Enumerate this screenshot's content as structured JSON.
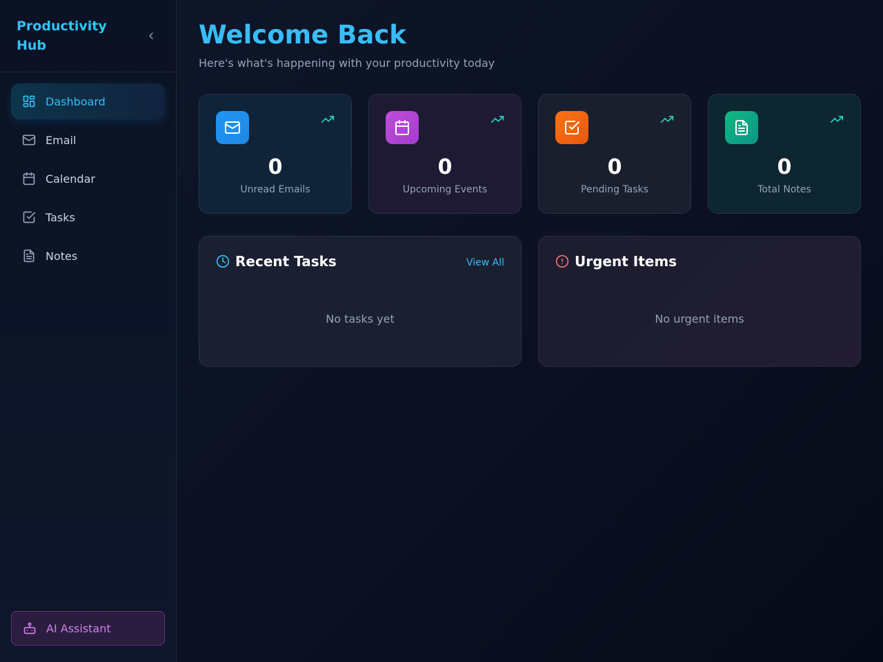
{
  "sidebar": {
    "brand": "Productivity Hub",
    "items": [
      {
        "label": "Dashboard",
        "icon": "dashboard-icon",
        "active": true
      },
      {
        "label": "Email",
        "icon": "mail-icon"
      },
      {
        "label": "Calendar",
        "icon": "calendar-icon"
      },
      {
        "label": "Tasks",
        "icon": "check-square-icon"
      },
      {
        "label": "Notes",
        "icon": "file-text-icon"
      }
    ],
    "ai_button": "AI Assistant"
  },
  "header": {
    "title": "Welcome Back",
    "subtitle": "Here's what's happening with your productivity today"
  },
  "stats": [
    {
      "value": "0",
      "label": "Unread Emails",
      "icon": "mail-icon",
      "color": "#2196f3"
    },
    {
      "value": "0",
      "label": "Upcoming Events",
      "icon": "calendar-icon",
      "color": "#c04ed8"
    },
    {
      "value": "0",
      "label": "Pending Tasks",
      "icon": "check-square-icon",
      "color": "#f97316"
    },
    {
      "value": "0",
      "label": "Total Notes",
      "icon": "file-text-icon",
      "color": "#10b981"
    }
  ],
  "recent_tasks": {
    "title": "Recent Tasks",
    "view_all": "View All",
    "empty": "No tasks yet"
  },
  "urgent_items": {
    "title": "Urgent Items",
    "empty": "No urgent items"
  },
  "colors": {
    "accent": "#38bdf8",
    "trend": "#2dd4bf",
    "urgent": "#f87171",
    "ai": "#d27ee8"
  }
}
